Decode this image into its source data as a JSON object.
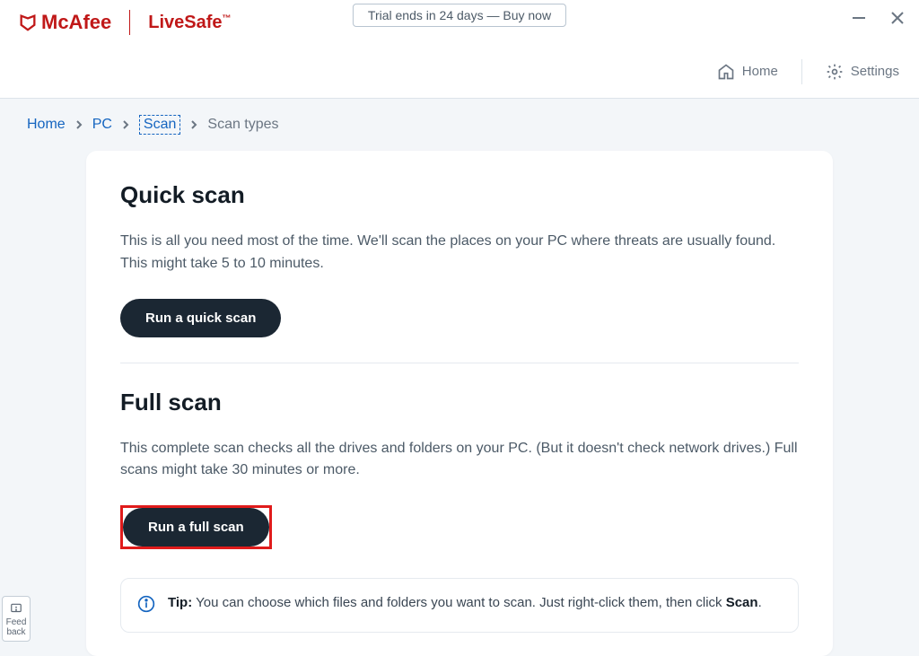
{
  "header": {
    "brand": "McAfee",
    "product": "LiveSafe",
    "trial": "Trial ends in 24 days — Buy now"
  },
  "toolbar": {
    "home": "Home",
    "settings": "Settings"
  },
  "breadcrumb": {
    "home": "Home",
    "pc": "PC",
    "scan": "Scan",
    "types": "Scan types"
  },
  "quick": {
    "title": "Quick scan",
    "desc": "This is all you need most of the time. We'll scan the places on your PC where threats are usually found. This might take 5 to 10 minutes.",
    "button": "Run a quick scan"
  },
  "full": {
    "title": "Full scan",
    "desc": "This complete scan checks all the drives and folders on your PC. (But it doesn't check network drives.) Full scans might take 30 minutes or more.",
    "button": "Run a full scan"
  },
  "tip": {
    "label": "Tip:",
    "text": " You can choose which files and folders you want to scan. Just right-click them, then click ",
    "bold": "Scan",
    "after": "."
  },
  "feedback": "Feed back"
}
